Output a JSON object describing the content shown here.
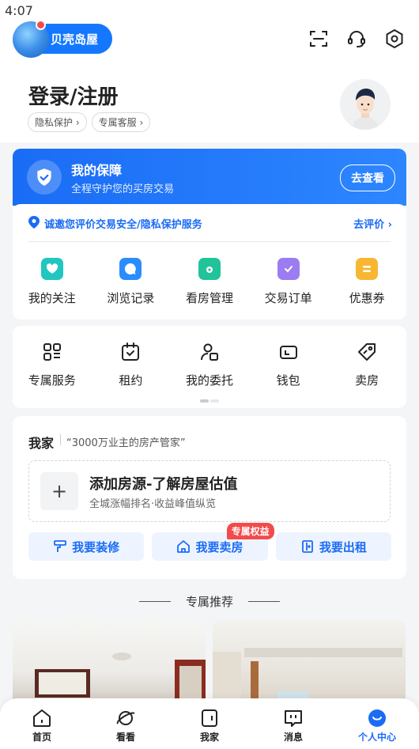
{
  "status_bar": {
    "time": "4:07"
  },
  "brand": {
    "name": "贝壳岛屋"
  },
  "header": {
    "login_title": "登录/注册",
    "pills": [
      "隐私保护",
      "专属客服"
    ]
  },
  "guarantee": {
    "title": "我的保障",
    "subtitle": "全程守护您的买房交易",
    "button": "去查看",
    "invite_text": "诚邀您评价交易安全/隐私保护服务",
    "invite_link": "去评价"
  },
  "quick_grid": [
    {
      "label": "我的关注",
      "icon": "heart-icon",
      "color": "#1fc7c0"
    },
    {
      "label": "浏览记录",
      "icon": "chat-icon",
      "color": "#2b8cff"
    },
    {
      "label": "看房管理",
      "icon": "folder-icon",
      "color": "#22c39a"
    },
    {
      "label": "交易订单",
      "icon": "clipboard-icon",
      "color": "#9b7cf2"
    },
    {
      "label": "优惠券",
      "icon": "coupon-icon",
      "color": "#f7b733"
    }
  ],
  "services": [
    {
      "label": "专属服务",
      "icon": "grid-icon"
    },
    {
      "label": "租约",
      "icon": "calendar-check-icon"
    },
    {
      "label": "我的委托",
      "icon": "person-doc-icon"
    },
    {
      "label": "钱包",
      "icon": "wallet-icon"
    },
    {
      "label": "卖房",
      "icon": "tag-icon"
    }
  ],
  "my_home": {
    "title": "我家",
    "quote": "“3000万业主的房产管家”",
    "add_title": "添加房源-了解房屋估值",
    "add_subtitle": "全城涨幅排名·收益峰值纵览",
    "actions": [
      {
        "label": "我要装修",
        "icon": "paint-roller-icon"
      },
      {
        "label": "我要卖房",
        "icon": "house-icon",
        "badge": "专属权益"
      },
      {
        "label": "我要出租",
        "icon": "door-icon"
      }
    ]
  },
  "recommend": {
    "title": "专属推荐"
  },
  "tabbar": [
    {
      "label": "首页",
      "icon": "home-icon",
      "active": false
    },
    {
      "label": "看看",
      "icon": "planet-icon",
      "active": false
    },
    {
      "label": "我家",
      "icon": "my-home-icon",
      "active": false
    },
    {
      "label": "消息",
      "icon": "message-icon",
      "active": false
    },
    {
      "label": "个人中心",
      "icon": "smile-icon",
      "active": true
    }
  ],
  "colors": {
    "accent": "#1a6cf5",
    "badge": "#f24b4b"
  }
}
